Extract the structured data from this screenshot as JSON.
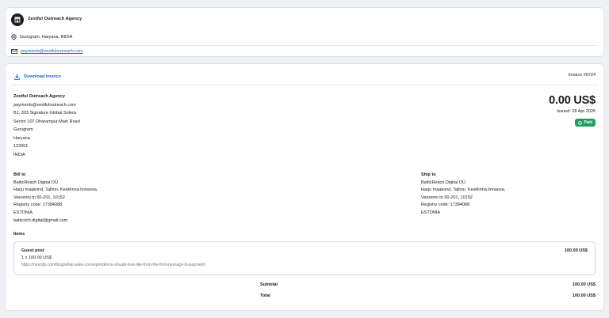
{
  "agency": {
    "name": "Zestful Outreach Agency",
    "location": "Gurugram, Haryana, INDIA",
    "email": "payments@zestfuloutreach.com"
  },
  "invoice": {
    "download_label": "Download invoice",
    "number_label": "Invoice #9724",
    "amount": "0.00 US$",
    "issued": "Issued: 28 Apr 2026",
    "status": "Paid"
  },
  "from": {
    "name": "Zestful Outreach Agency",
    "lines": [
      "payments@zestfuloutreach.com",
      "B1, 303 Signature Global Solera",
      "Sector 107 Dharampur Main Road",
      "Gurugram",
      "Haryana",
      "122001",
      "INDIA"
    ]
  },
  "bill_to": {
    "heading": "Bill to",
    "lines": [
      "BalticReach Digital OÜ",
      "Harju maakond, Tallinn, Kesklinna linnaosa,",
      "Veerenni tn 50-201, 10152",
      "Registry code: 17384088",
      "ESTONIA",
      "balticrich.digital@gmail.com"
    ]
  },
  "ship_to": {
    "heading": "Ship to",
    "lines": [
      "BalticReach Digital OÜ",
      "Harju maakond, Tallinn, Kesklinna linnaosa,",
      "Veerenni tn 50-201, 10152",
      "Registry code: 17384088",
      "ESTONIA"
    ]
  },
  "items": {
    "title": "Items",
    "list": [
      {
        "name": "Guest post",
        "total": "100.00 US$",
        "qty": "1 x 100.00 US$",
        "url": "https://nexcdp.com/blog/what-sales-correspondence-should-look-like-from-the-first-message-to-payment/"
      }
    ]
  },
  "summary": {
    "subtotal_label": "Subtotal",
    "subtotal_value": "100.00 US$",
    "total_label": "Total",
    "total_value": "100.00 US$"
  },
  "icons": {
    "logo": "storefront-icon",
    "location": "map-pin-icon",
    "email": "envelope-icon",
    "download": "download-icon",
    "paid": "check-circle-icon"
  },
  "colors": {
    "link": "#1f5fd6",
    "paid_badge": "#1f9d5c",
    "background": "#eef0f4"
  }
}
